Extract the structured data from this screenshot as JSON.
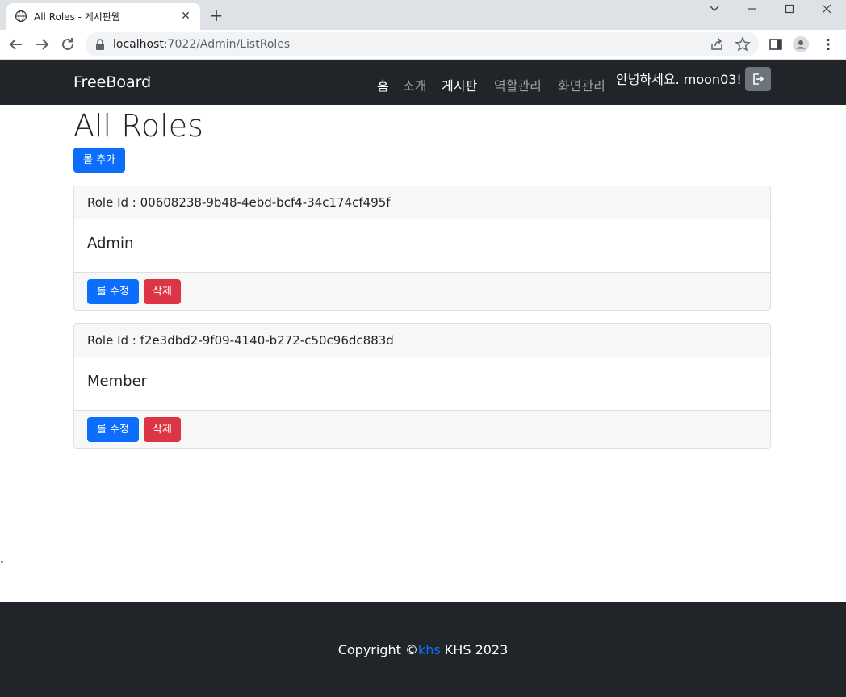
{
  "browser": {
    "tab_title": "All Roles - 게시판웹",
    "url_host": "localhost",
    "url_path": ":7022/Admin/ListRoles"
  },
  "nav": {
    "brand": "FreeBoard",
    "links": [
      {
        "label": "홈"
      },
      {
        "label": "소개"
      },
      {
        "label": "게시판"
      },
      {
        "label": "역활관리"
      },
      {
        "label": "화면관리"
      }
    ],
    "greeting": "안녕하세요. moon03!"
  },
  "main": {
    "title": "All Roles",
    "add_button": "롤 추가",
    "roles": [
      {
        "id_label": "Role Id : 00608238-9b48-4ebd-bcf4-34c174cf495f",
        "name": "Admin",
        "edit": "롤 수정",
        "delete": "삭제"
      },
      {
        "id_label": "Role Id : f2e3dbd2-9f09-4140-b272-c50c96dc883d",
        "name": "Member",
        "edit": "롤 수정",
        "delete": "삭제"
      }
    ],
    "stray_mark": "\""
  },
  "footer": {
    "prefix": "Copyright ©",
    "link": "khs",
    "suffix": " KHS 2023"
  },
  "colors": {
    "primary": "#0d6efd",
    "danger": "#dc3545",
    "navbar": "#212529",
    "secondary": "#6c757d"
  }
}
